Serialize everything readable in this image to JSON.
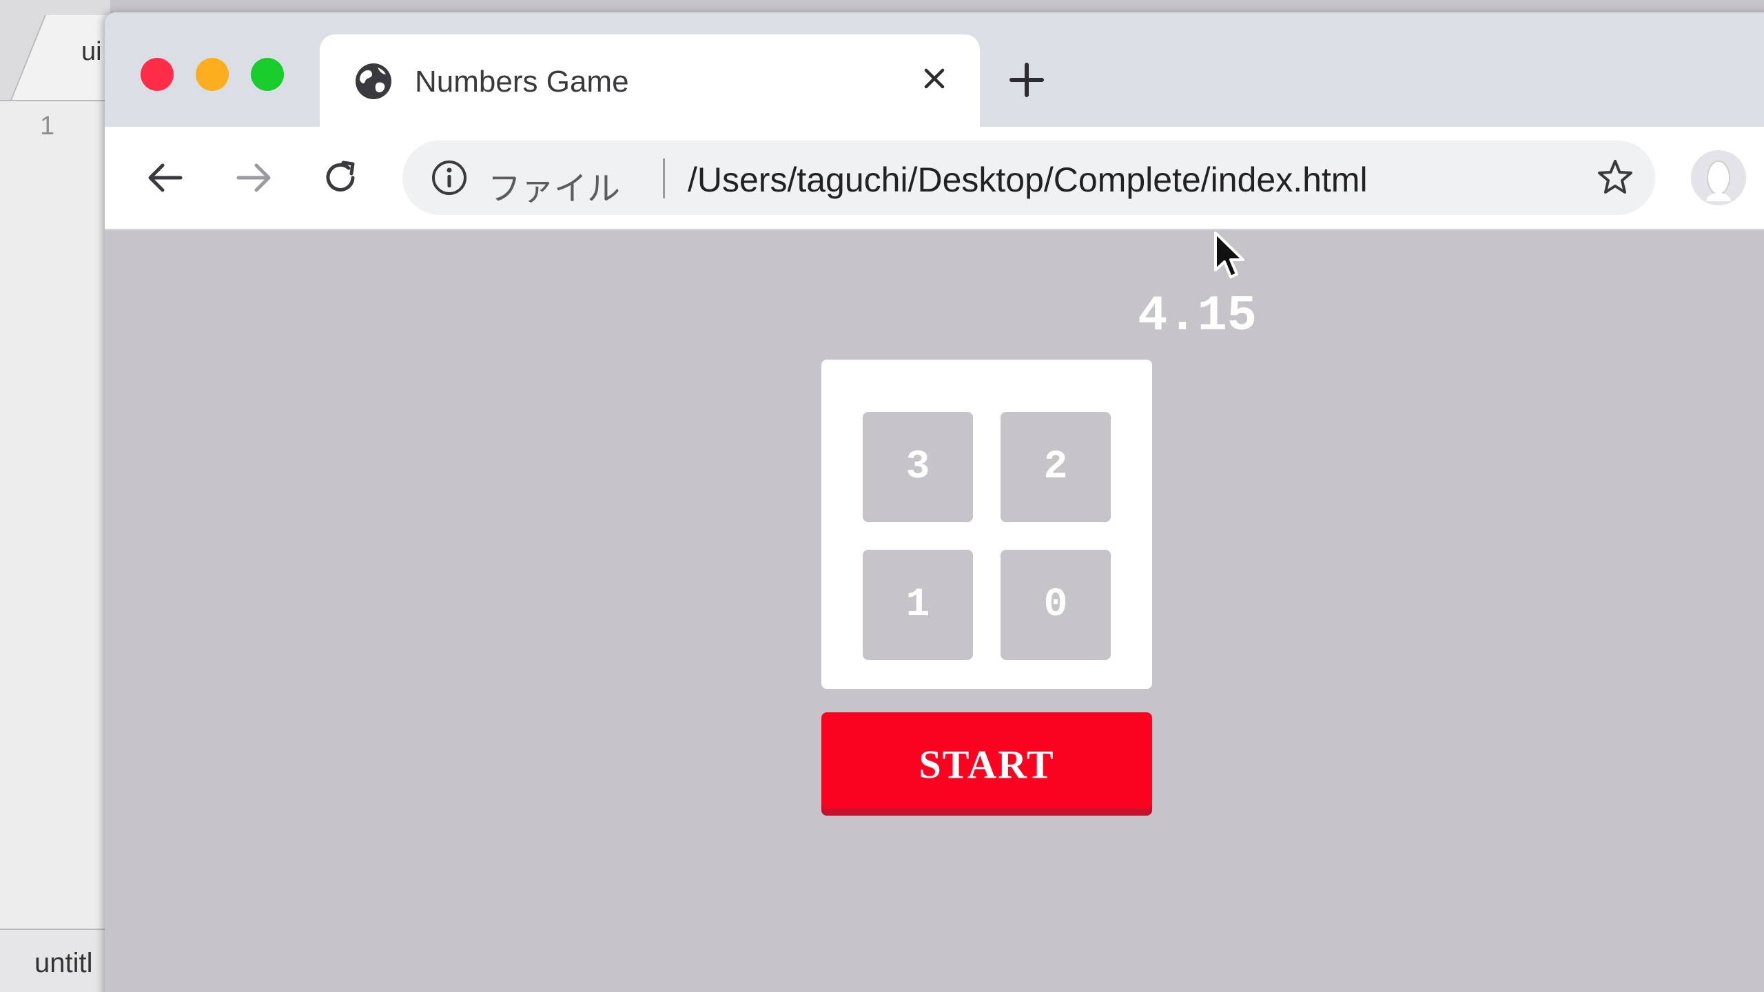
{
  "editor": {
    "tab_label": "ui",
    "line_number": "1",
    "status_label": "untitl"
  },
  "browser": {
    "tab": {
      "title": "Numbers Game",
      "icon": "globe-icon"
    },
    "toolbar": {
      "scheme_label": "ファイル",
      "url": "/Users/taguchi/Desktop/Complete/index.html"
    }
  },
  "game": {
    "timer": "4.15",
    "cells": [
      "3",
      "2",
      "1",
      "0"
    ],
    "start_label": "START"
  },
  "colors": {
    "page_background": "#c6c3c9",
    "start_button": "#f90320",
    "close_red": "#fe2d47",
    "minimize_yellow": "#fcae1f",
    "maximize_green": "#17cc2b"
  }
}
